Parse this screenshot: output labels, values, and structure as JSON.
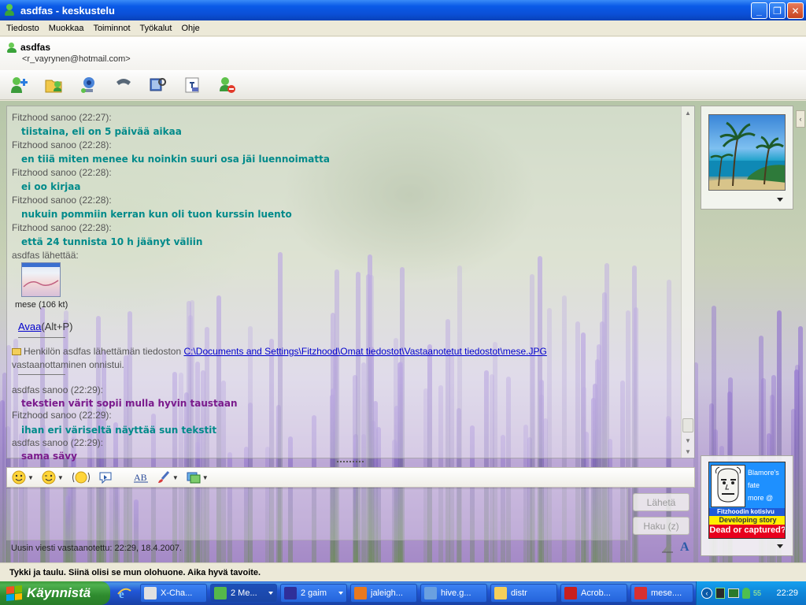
{
  "window": {
    "title": "asdfas - keskustelu"
  },
  "menu": [
    "Tiedosto",
    "Muokkaa",
    "Toiminnot",
    "Työkalut",
    "Ohje"
  ],
  "contact": {
    "name": "asdfas",
    "email": "<r_vayrynen@hotmail.com>"
  },
  "toolbar_icons": [
    "invite-icon",
    "send-files-icon",
    "webcam-icon",
    "voice-call-icon",
    "video-icon",
    "games-icon",
    "block-icon"
  ],
  "chat": {
    "messages": [
      {
        "header": "Fitzhood sanoo (22:27):",
        "text": "tiistaina, eli on 5 päivää aikaa",
        "who": "f"
      },
      {
        "header": "Fitzhood sanoo (22:28):",
        "text": "en tiiä miten menee ku noinkin suuri osa jäi luennoimatta",
        "who": "f"
      },
      {
        "header": "Fitzhood sanoo (22:28):",
        "text": "ei oo kirjaa",
        "who": "f"
      },
      {
        "header": "Fitzhood sanoo (22:28):",
        "text": "nukuin pommiin kerran kun oli tuon kurssin luento",
        "who": "f"
      },
      {
        "header": "Fitzhood sanoo (22:28):",
        "text": "että 24 tunnista 10 h jäänyt väliin",
        "who": "f"
      }
    ],
    "transfer_header": "asdfas lähettää:",
    "file_caption": "mese (106 kt)",
    "open_link": "Avaa",
    "open_shortcut": "(Alt+P)",
    "receipt_prefix": "Henkilön asdfas lähettämän tiedoston ",
    "receipt_path": "C:\\Documents and Settings\\Fitzhood\\Omat tiedostot\\Vastaanotetut tiedostot\\mese.JPG",
    "receipt_suffix": "vastaanottaminen onnistui.",
    "messages2": [
      {
        "header": "asdfas sanoo (22:29):",
        "text": "tekstien värit sopii mulla hyvin taustaan",
        "who": "a"
      },
      {
        "header": "Fitzhood sanoo (22:29):",
        "text": "ihan eri väriseltä näyttää sun tekstit",
        "who": "f"
      },
      {
        "header": "asdfas sanoo (22:29):",
        "text": "sama sävy",
        "who": "a"
      }
    ]
  },
  "input": {
    "send_label": "Lähetä",
    "search_label": "Haku (z)",
    "last_message_status": "Uusin viesti vastaanotettu: 22:29, 18.4.2007."
  },
  "ad": {
    "line1": "Blamore's",
    "line2": "fate",
    "line3": "more @",
    "strip": "Fitzhoodin kotisivu",
    "yellow": "Developing story",
    "red": "Dead or captured?"
  },
  "window_status": "Tykki ja taulu. Siinä olisi se mun olohuone. Aika hyvä tavoite.",
  "taskbar": {
    "start_label": "Käynnistä",
    "tasks": [
      {
        "label": "X-Cha...",
        "icon": "chat-x-icon",
        "color": "#e0e0e0"
      },
      {
        "label": "2 Me...",
        "icon": "messenger-icon",
        "color": "#55b84a",
        "active": true,
        "dropdown": true
      },
      {
        "label": "2 gaim",
        "icon": "gaim-icon",
        "color": "#2f2f9a",
        "dropdown": true
      },
      {
        "label": "jaleigh...",
        "icon": "firefox-icon",
        "color": "#e8791e"
      },
      {
        "label": "hive.g...",
        "icon": "app-window-icon",
        "color": "#6aa0e0"
      },
      {
        "label": "distr",
        "icon": "folder-icon",
        "color": "#f4cf5a"
      },
      {
        "label": "Acrob...",
        "icon": "acrobat-icon",
        "color": "#c8201e"
      },
      {
        "label": "mese....",
        "icon": "image-viewer-icon",
        "color": "#d83030"
      }
    ],
    "clock": "22:29",
    "tray_num": "55"
  }
}
